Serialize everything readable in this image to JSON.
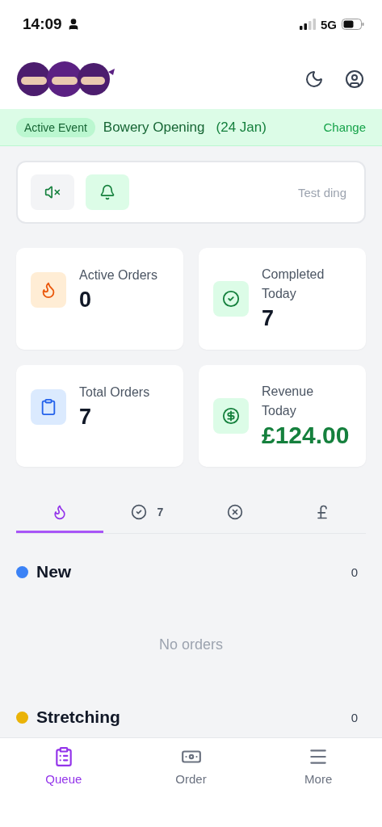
{
  "status_bar": {
    "time": "14:09",
    "network": "5G"
  },
  "event_banner": {
    "badge": "Active Event",
    "name": "Bowery Opening",
    "date": "(24 Jan)",
    "action": "Change"
  },
  "sound_panel": {
    "muted": false,
    "bell_on": true,
    "test_label": "Test ding"
  },
  "stats": [
    {
      "kind": "active",
      "label": "Active Orders",
      "value": "0"
    },
    {
      "kind": "completed",
      "label": "Completed Today",
      "value": "7"
    },
    {
      "kind": "total",
      "label": "Total Orders",
      "value": "7"
    },
    {
      "kind": "revenue",
      "label": "Revenue Today",
      "value": "£124.00"
    }
  ],
  "tabs": [
    {
      "kind": "active",
      "selected": true
    },
    {
      "kind": "completed",
      "selected": false,
      "count": "7"
    },
    {
      "kind": "cancelled",
      "selected": false
    },
    {
      "kind": "revenue",
      "selected": false
    }
  ],
  "sections": [
    {
      "name": "New",
      "color": "#3b82f6",
      "count": "0",
      "empty_text": "No orders"
    },
    {
      "name": "Stretching",
      "color": "#eab308",
      "count": "0"
    }
  ],
  "bottom_nav": [
    {
      "kind": "queue",
      "label": "Queue",
      "selected": true
    },
    {
      "kind": "order",
      "label": "Order",
      "selected": false
    },
    {
      "kind": "more",
      "label": "More",
      "selected": false
    }
  ]
}
